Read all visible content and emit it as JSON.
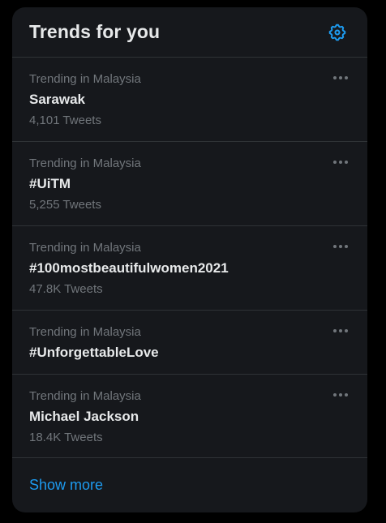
{
  "header": {
    "title": "Trends for you",
    "settings_icon": "gear-icon"
  },
  "trends": [
    {
      "context": "Trending in Malaysia",
      "name": "Sarawak",
      "count": "4,101 Tweets"
    },
    {
      "context": "Trending in Malaysia",
      "name": "#UiTM",
      "count": "5,255 Tweets"
    },
    {
      "context": "Trending in Malaysia",
      "name": "#100mostbeautifulwomen2021",
      "count": "47.8K Tweets"
    },
    {
      "context": "Trending in Malaysia",
      "name": "#UnforgettableLove",
      "count": ""
    },
    {
      "context": "Trending in Malaysia",
      "name": "Michael Jackson",
      "count": "18.4K Tweets"
    }
  ],
  "footer": {
    "show_more_label": "Show more"
  },
  "colors": {
    "accent": "#1d9bf0",
    "panel_bg": "#16181c",
    "text_primary": "#e7e9ea",
    "text_secondary": "#71767b",
    "divider": "#2f3336"
  }
}
